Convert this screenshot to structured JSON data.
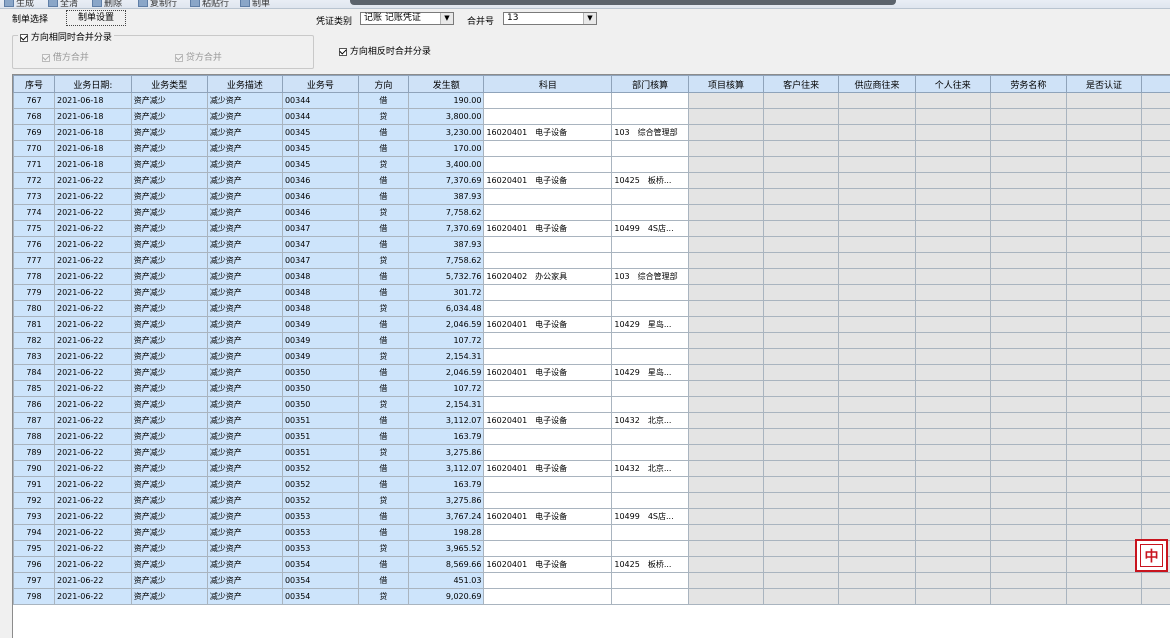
{
  "toolbar": {
    "buttons": [
      "生成",
      "全清",
      "删除",
      "复制行",
      "粘贴行",
      "制单"
    ]
  },
  "options": {
    "tab_select": "制单选择",
    "tab_settings": "制单设置",
    "voucher_type_label": "凭证类别",
    "voucher_type_value": "记账 记账凭证",
    "merge_no_label": "合并号",
    "merge_no_value": "13",
    "same_dir_merge_label": "方向相同时合并分录",
    "debit_merge_label": "借方合并",
    "credit_merge_label": "贷方合并",
    "opposite_dir_merge_label": "方向相反时合并分录"
  },
  "grid": {
    "columns": [
      "序号",
      "业务日期:",
      "业务类型",
      "业务描述",
      "业务号",
      "方向",
      "发生额",
      "科目",
      "部门核算",
      "项目核算",
      "客户往来",
      "供应商往来",
      "个人往来",
      "劳务名称",
      "是否认证"
    ],
    "rows": [
      {
        "no": "767",
        "date": "2021-06-18",
        "type": "资产减少",
        "desc": "减少资产",
        "biz": "00344",
        "dir": "借",
        "amt": "190.00",
        "subj": "",
        "dept": ""
      },
      {
        "no": "768",
        "date": "2021-06-18",
        "type": "资产减少",
        "desc": "减少资产",
        "biz": "00344",
        "dir": "贷",
        "amt": "3,800.00",
        "subj": "",
        "dept": ""
      },
      {
        "no": "769",
        "date": "2021-06-18",
        "type": "资产减少",
        "desc": "减少资产",
        "biz": "00345",
        "dir": "借",
        "amt": "3,230.00",
        "subj": "16020401　电子设备",
        "dept": "103　综合管理部"
      },
      {
        "no": "770",
        "date": "2021-06-18",
        "type": "资产减少",
        "desc": "减少资产",
        "biz": "00345",
        "dir": "借",
        "amt": "170.00",
        "subj": "",
        "dept": ""
      },
      {
        "no": "771",
        "date": "2021-06-18",
        "type": "资产减少",
        "desc": "减少资产",
        "biz": "00345",
        "dir": "贷",
        "amt": "3,400.00",
        "subj": "",
        "dept": ""
      },
      {
        "no": "772",
        "date": "2021-06-22",
        "type": "资产减少",
        "desc": "减少资产",
        "biz": "00346",
        "dir": "借",
        "amt": "7,370.69",
        "subj": "16020401　电子设备",
        "dept": "10425　板桥..."
      },
      {
        "no": "773",
        "date": "2021-06-22",
        "type": "资产减少",
        "desc": "减少资产",
        "biz": "00346",
        "dir": "借",
        "amt": "387.93",
        "subj": "",
        "dept": ""
      },
      {
        "no": "774",
        "date": "2021-06-22",
        "type": "资产减少",
        "desc": "减少资产",
        "biz": "00346",
        "dir": "贷",
        "amt": "7,758.62",
        "subj": "",
        "dept": ""
      },
      {
        "no": "775",
        "date": "2021-06-22",
        "type": "资产减少",
        "desc": "减少资产",
        "biz": "00347",
        "dir": "借",
        "amt": "7,370.69",
        "subj": "16020401　电子设备",
        "dept": "10499　4S店..."
      },
      {
        "no": "776",
        "date": "2021-06-22",
        "type": "资产减少",
        "desc": "减少资产",
        "biz": "00347",
        "dir": "借",
        "amt": "387.93",
        "subj": "",
        "dept": ""
      },
      {
        "no": "777",
        "date": "2021-06-22",
        "type": "资产减少",
        "desc": "减少资产",
        "biz": "00347",
        "dir": "贷",
        "amt": "7,758.62",
        "subj": "",
        "dept": ""
      },
      {
        "no": "778",
        "date": "2021-06-22",
        "type": "资产减少",
        "desc": "减少资产",
        "biz": "00348",
        "dir": "借",
        "amt": "5,732.76",
        "subj": "16020402　办公家具",
        "dept": "103　综合管理部"
      },
      {
        "no": "779",
        "date": "2021-06-22",
        "type": "资产减少",
        "desc": "减少资产",
        "biz": "00348",
        "dir": "借",
        "amt": "301.72",
        "subj": "",
        "dept": ""
      },
      {
        "no": "780",
        "date": "2021-06-22",
        "type": "资产减少",
        "desc": "减少资产",
        "biz": "00348",
        "dir": "贷",
        "amt": "6,034.48",
        "subj": "",
        "dept": ""
      },
      {
        "no": "781",
        "date": "2021-06-22",
        "type": "资产减少",
        "desc": "减少资产",
        "biz": "00349",
        "dir": "借",
        "amt": "2,046.59",
        "subj": "16020401　电子设备",
        "dept": "10429　星岛..."
      },
      {
        "no": "782",
        "date": "2021-06-22",
        "type": "资产减少",
        "desc": "减少资产",
        "biz": "00349",
        "dir": "借",
        "amt": "107.72",
        "subj": "",
        "dept": ""
      },
      {
        "no": "783",
        "date": "2021-06-22",
        "type": "资产减少",
        "desc": "减少资产",
        "biz": "00349",
        "dir": "贷",
        "amt": "2,154.31",
        "subj": "",
        "dept": ""
      },
      {
        "no": "784",
        "date": "2021-06-22",
        "type": "资产减少",
        "desc": "减少资产",
        "biz": "00350",
        "dir": "借",
        "amt": "2,046.59",
        "subj": "16020401　电子设备",
        "dept": "10429　星岛..."
      },
      {
        "no": "785",
        "date": "2021-06-22",
        "type": "资产减少",
        "desc": "减少资产",
        "biz": "00350",
        "dir": "借",
        "amt": "107.72",
        "subj": "",
        "dept": ""
      },
      {
        "no": "786",
        "date": "2021-06-22",
        "type": "资产减少",
        "desc": "减少资产",
        "biz": "00350",
        "dir": "贷",
        "amt": "2,154.31",
        "subj": "",
        "dept": ""
      },
      {
        "no": "787",
        "date": "2021-06-22",
        "type": "资产减少",
        "desc": "减少资产",
        "biz": "00351",
        "dir": "借",
        "amt": "3,112.07",
        "subj": "16020401　电子设备",
        "dept": "10432　北京..."
      },
      {
        "no": "788",
        "date": "2021-06-22",
        "type": "资产减少",
        "desc": "减少资产",
        "biz": "00351",
        "dir": "借",
        "amt": "163.79",
        "subj": "",
        "dept": ""
      },
      {
        "no": "789",
        "date": "2021-06-22",
        "type": "资产减少",
        "desc": "减少资产",
        "biz": "00351",
        "dir": "贷",
        "amt": "3,275.86",
        "subj": "",
        "dept": ""
      },
      {
        "no": "790",
        "date": "2021-06-22",
        "type": "资产减少",
        "desc": "减少资产",
        "biz": "00352",
        "dir": "借",
        "amt": "3,112.07",
        "subj": "16020401　电子设备",
        "dept": "10432　北京..."
      },
      {
        "no": "791",
        "date": "2021-06-22",
        "type": "资产减少",
        "desc": "减少资产",
        "biz": "00352",
        "dir": "借",
        "amt": "163.79",
        "subj": "",
        "dept": ""
      },
      {
        "no": "792",
        "date": "2021-06-22",
        "type": "资产减少",
        "desc": "减少资产",
        "biz": "00352",
        "dir": "贷",
        "amt": "3,275.86",
        "subj": "",
        "dept": ""
      },
      {
        "no": "793",
        "date": "2021-06-22",
        "type": "资产减少",
        "desc": "减少资产",
        "biz": "00353",
        "dir": "借",
        "amt": "3,767.24",
        "subj": "16020401　电子设备",
        "dept": "10499　4S店..."
      },
      {
        "no": "794",
        "date": "2021-06-22",
        "type": "资产减少",
        "desc": "减少资产",
        "biz": "00353",
        "dir": "借",
        "amt": "198.28",
        "subj": "",
        "dept": ""
      },
      {
        "no": "795",
        "date": "2021-06-22",
        "type": "资产减少",
        "desc": "减少资产",
        "biz": "00353",
        "dir": "贷",
        "amt": "3,965.52",
        "subj": "",
        "dept": ""
      },
      {
        "no": "796",
        "date": "2021-06-22",
        "type": "资产减少",
        "desc": "减少资产",
        "biz": "00354",
        "dir": "借",
        "amt": "8,569.66",
        "subj": "16020401　电子设备",
        "dept": "10425　板桥..."
      },
      {
        "no": "797",
        "date": "2021-06-22",
        "type": "资产减少",
        "desc": "减少资产",
        "biz": "00354",
        "dir": "借",
        "amt": "451.03",
        "subj": "",
        "dept": ""
      },
      {
        "no": "798",
        "date": "2021-06-22",
        "type": "资产减少",
        "desc": "减少资产",
        "biz": "00354",
        "dir": "贷",
        "amt": "9,020.69",
        "subj": "",
        "dept": ""
      }
    ]
  },
  "ime": {
    "label": "中",
    "color": "#c8141e"
  }
}
